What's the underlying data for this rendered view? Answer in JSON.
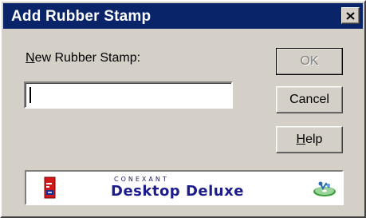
{
  "window": {
    "title": "Add Rubber Stamp"
  },
  "form": {
    "label_prefix": "N",
    "label_rest": "ew Rubber Stamp:",
    "input_value": ""
  },
  "buttons": {
    "ok": "OK",
    "cancel": "Cancel",
    "help_prefix": "H",
    "help_rest": "elp"
  },
  "banner": {
    "brand_top": "CONEXANT",
    "brand_main": "Desktop Deluxe"
  },
  "colors": {
    "titlebar": "#0a246a",
    "face": "#d4d0c8",
    "brand_text": "#1c1c8c"
  },
  "icons": {
    "close": "close-icon",
    "banner_left": "document-logo-icon",
    "banner_right": "cd-disc-icon"
  }
}
